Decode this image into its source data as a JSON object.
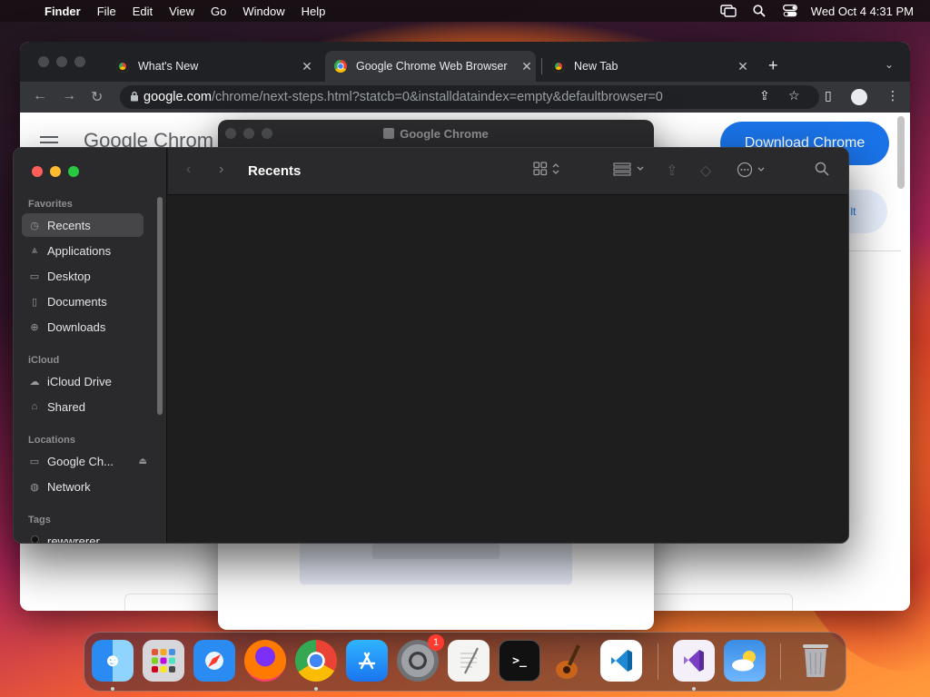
{
  "menubar": {
    "app_name": "Finder",
    "menus": [
      "File",
      "Edit",
      "View",
      "Go",
      "Window",
      "Help"
    ],
    "clock": "Wed Oct 4  4:31 PM"
  },
  "chrome": {
    "tabs": [
      {
        "title": "What's New",
        "active": false
      },
      {
        "title": "Google Chrome Web Browser",
        "active": true
      },
      {
        "title": "New Tab",
        "active": false
      }
    ],
    "url_domain": "google.com",
    "url_path": "/chrome/next-steps.html?statcb=0&installdataindex=empty&defaultbrowser=0",
    "page": {
      "logo_text": "Google Chrom",
      "download_label": "Download Chrome",
      "secondary_label": "lt"
    }
  },
  "dialog": {
    "title": "Google Chrome"
  },
  "finder": {
    "title": "Recents",
    "sidebar": {
      "favorites_header": "Favorites",
      "favorites": [
        {
          "label": "Recents",
          "icon": "clock-icon",
          "selected": true
        },
        {
          "label": "Applications",
          "icon": "applications-icon",
          "selected": false
        },
        {
          "label": "Desktop",
          "icon": "desktop-icon",
          "selected": false
        },
        {
          "label": "Documents",
          "icon": "document-icon",
          "selected": false
        },
        {
          "label": "Downloads",
          "icon": "download-icon",
          "selected": false
        }
      ],
      "icloud_header": "iCloud",
      "icloud": [
        {
          "label": "iCloud Drive",
          "icon": "cloud-icon"
        },
        {
          "label": "Shared",
          "icon": "shared-folder-icon"
        }
      ],
      "locations_header": "Locations",
      "locations": [
        {
          "label": "Google Ch...",
          "icon": "drive-icon"
        },
        {
          "label": "Network",
          "icon": "globe-icon"
        }
      ],
      "tags_header": "Tags",
      "tags": [
        {
          "label": "rewwrerer",
          "color": "#000000"
        }
      ]
    }
  },
  "dock": {
    "apps": [
      {
        "name": "Finder",
        "icon": "finder-icon",
        "running": true
      },
      {
        "name": "Launchpad",
        "icon": "launchpad-icon",
        "running": false
      },
      {
        "name": "Safari",
        "icon": "safari-icon",
        "running": false
      },
      {
        "name": "Firefox",
        "icon": "firefox-icon",
        "running": false
      },
      {
        "name": "Google Chrome",
        "icon": "chrome-icon",
        "running": true
      },
      {
        "name": "App Store",
        "icon": "app-store-icon",
        "running": false
      },
      {
        "name": "System Settings",
        "icon": "settings-icon",
        "running": false,
        "badge": "1"
      },
      {
        "name": "TextEdit",
        "icon": "textedit-icon",
        "running": false
      },
      {
        "name": "Terminal",
        "icon": "terminal-icon",
        "running": false
      },
      {
        "name": "GarageBand",
        "icon": "garageband-icon",
        "running": false
      },
      {
        "name": "Visual Studio Code",
        "icon": "vscode-icon",
        "running": false
      },
      {
        "name": "Visual Studio",
        "icon": "visual-studio-icon",
        "running": true
      },
      {
        "name": "Weather",
        "icon": "weather-icon",
        "running": false
      },
      {
        "name": "Trash",
        "icon": "trash-icon",
        "running": false
      }
    ]
  }
}
